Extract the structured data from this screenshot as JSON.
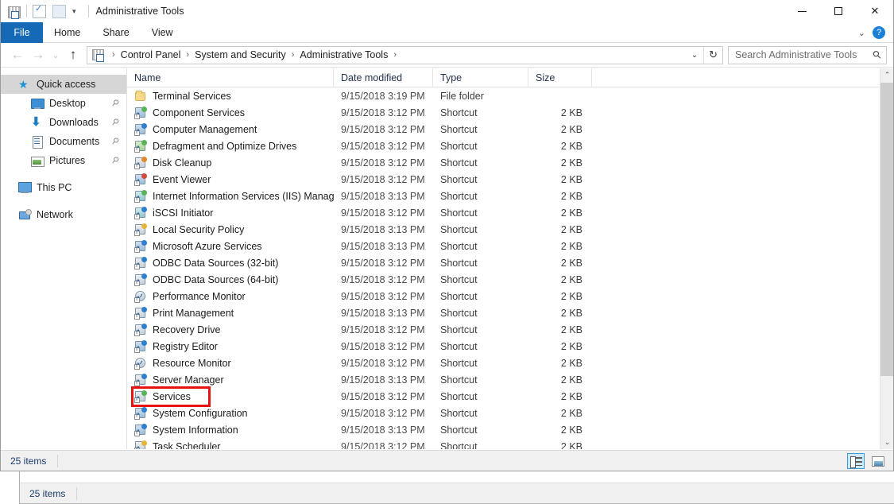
{
  "window": {
    "title": "Administrative Tools",
    "minimize_label": "—",
    "maximize_label": "□",
    "close_label": "✕"
  },
  "quick_access_toolbar": {
    "system_icon": "admin-tools-icon",
    "properties_icon": "properties-icon",
    "new_folder_icon": "new-folder-icon",
    "customize_caret": "▾"
  },
  "ribbon": {
    "tabs": [
      {
        "label": "File",
        "active": true
      },
      {
        "label": "Home",
        "active": false
      },
      {
        "label": "Share",
        "active": false
      },
      {
        "label": "View",
        "active": false
      }
    ],
    "collapse_caret": "⌄",
    "help_label": "?"
  },
  "navigation": {
    "back_label": "←",
    "forward_label": "→",
    "recent_label": "⌄",
    "up_label": "↑",
    "dropdown_label": "⌄",
    "refresh_label": "↻"
  },
  "breadcrumb": {
    "icon": "admin-tools-icon",
    "separator": "›",
    "items": [
      "Control Panel",
      "System and Security",
      "Administrative Tools"
    ],
    "trailing_separator": "›"
  },
  "search": {
    "placeholder": "Search Administrative Tools",
    "icon": "search-icon"
  },
  "sidebar": {
    "items": [
      {
        "label": "Quick access",
        "icon": "star-icon",
        "level": 0,
        "selected": true,
        "pinned": false
      },
      {
        "label": "Desktop",
        "icon": "desktop-icon",
        "level": 1,
        "selected": false,
        "pinned": true
      },
      {
        "label": "Downloads",
        "icon": "download-icon",
        "level": 1,
        "selected": false,
        "pinned": true
      },
      {
        "label": "Documents",
        "icon": "document-icon",
        "level": 1,
        "selected": false,
        "pinned": true
      },
      {
        "label": "Pictures",
        "icon": "picture-icon",
        "level": 1,
        "selected": false,
        "pinned": true
      },
      {
        "label": "This PC",
        "icon": "computer-icon",
        "level": 0,
        "selected": false,
        "pinned": false
      },
      {
        "label": "Network",
        "icon": "network-icon",
        "level": 0,
        "selected": false,
        "pinned": false
      }
    ],
    "pin_glyph": "📌"
  },
  "columns": {
    "name": "Name",
    "date_modified": "Date modified",
    "type": "Type",
    "size": "Size",
    "sort_caret": "▲"
  },
  "files": [
    {
      "name": "Terminal Services",
      "date": "9/15/2018 3:19 PM",
      "type": "File folder",
      "size": "",
      "icon": "folder-icon"
    },
    {
      "name": "Component Services",
      "date": "9/15/2018 3:12 PM",
      "type": "Shortcut",
      "size": "2 KB",
      "icon": "component-services-icon"
    },
    {
      "name": "Computer Management",
      "date": "9/15/2018 3:12 PM",
      "type": "Shortcut",
      "size": "2 KB",
      "icon": "computer-management-icon"
    },
    {
      "name": "Defragment and Optimize Drives",
      "date": "9/15/2018 3:12 PM",
      "type": "Shortcut",
      "size": "2 KB",
      "icon": "defragment-icon"
    },
    {
      "name": "Disk Cleanup",
      "date": "9/15/2018 3:12 PM",
      "type": "Shortcut",
      "size": "2 KB",
      "icon": "disk-cleanup-icon"
    },
    {
      "name": "Event Viewer",
      "date": "9/15/2018 3:12 PM",
      "type": "Shortcut",
      "size": "2 KB",
      "icon": "event-viewer-icon"
    },
    {
      "name": "Internet Information Services (IIS) Manager",
      "date": "9/15/2018 3:13 PM",
      "type": "Shortcut",
      "size": "2 KB",
      "icon": "iis-manager-icon"
    },
    {
      "name": "iSCSI Initiator",
      "date": "9/15/2018 3:12 PM",
      "type": "Shortcut",
      "size": "2 KB",
      "icon": "iscsi-initiator-icon"
    },
    {
      "name": "Local Security Policy",
      "date": "9/15/2018 3:13 PM",
      "type": "Shortcut",
      "size": "2 KB",
      "icon": "local-security-policy-icon"
    },
    {
      "name": "Microsoft Azure Services",
      "date": "9/15/2018 3:13 PM",
      "type": "Shortcut",
      "size": "2 KB",
      "icon": "azure-services-icon"
    },
    {
      "name": "ODBC Data Sources (32-bit)",
      "date": "9/15/2018 3:12 PM",
      "type": "Shortcut",
      "size": "2 KB",
      "icon": "odbc-icon"
    },
    {
      "name": "ODBC Data Sources (64-bit)",
      "date": "9/15/2018 3:12 PM",
      "type": "Shortcut",
      "size": "2 KB",
      "icon": "odbc-icon"
    },
    {
      "name": "Performance Monitor",
      "date": "9/15/2018 3:12 PM",
      "type": "Shortcut",
      "size": "2 KB",
      "icon": "performance-monitor-icon"
    },
    {
      "name": "Print Management",
      "date": "9/15/2018 3:13 PM",
      "type": "Shortcut",
      "size": "2 KB",
      "icon": "print-management-icon"
    },
    {
      "name": "Recovery Drive",
      "date": "9/15/2018 3:12 PM",
      "type": "Shortcut",
      "size": "2 KB",
      "icon": "recovery-drive-icon"
    },
    {
      "name": "Registry Editor",
      "date": "9/15/2018 3:12 PM",
      "type": "Shortcut",
      "size": "2 KB",
      "icon": "registry-editor-icon"
    },
    {
      "name": "Resource Monitor",
      "date": "9/15/2018 3:12 PM",
      "type": "Shortcut",
      "size": "2 KB",
      "icon": "resource-monitor-icon"
    },
    {
      "name": "Server Manager",
      "date": "9/15/2018 3:13 PM",
      "type": "Shortcut",
      "size": "2 KB",
      "icon": "server-manager-icon"
    },
    {
      "name": "Services",
      "date": "9/15/2018 3:12 PM",
      "type": "Shortcut",
      "size": "2 KB",
      "icon": "services-icon",
      "highlighted": true
    },
    {
      "name": "System Configuration",
      "date": "9/15/2018 3:12 PM",
      "type": "Shortcut",
      "size": "2 KB",
      "icon": "system-configuration-icon"
    },
    {
      "name": "System Information",
      "date": "9/15/2018 3:13 PM",
      "type": "Shortcut",
      "size": "2 KB",
      "icon": "system-information-icon"
    },
    {
      "name": "Task Scheduler",
      "date": "9/15/2018 3:12 PM",
      "type": "Shortcut",
      "size": "2 KB",
      "icon": "task-scheduler-icon"
    }
  ],
  "status": {
    "item_count": "25 items",
    "background_item_count": "25 items"
  },
  "view_buttons": {
    "details_icon": "details-view-icon",
    "thumbnails_icon": "large-icons-view-icon"
  },
  "scrollbar": {
    "up_arrow": "⌃",
    "down_arrow": "⌄"
  },
  "colors": {
    "file_tab_blue": "#1569b5",
    "highlight_red": "#e8120f",
    "selection_gray": "#d6d6d6",
    "help_blue": "#1a80d8",
    "column_header_text": "#1f2f4a"
  }
}
